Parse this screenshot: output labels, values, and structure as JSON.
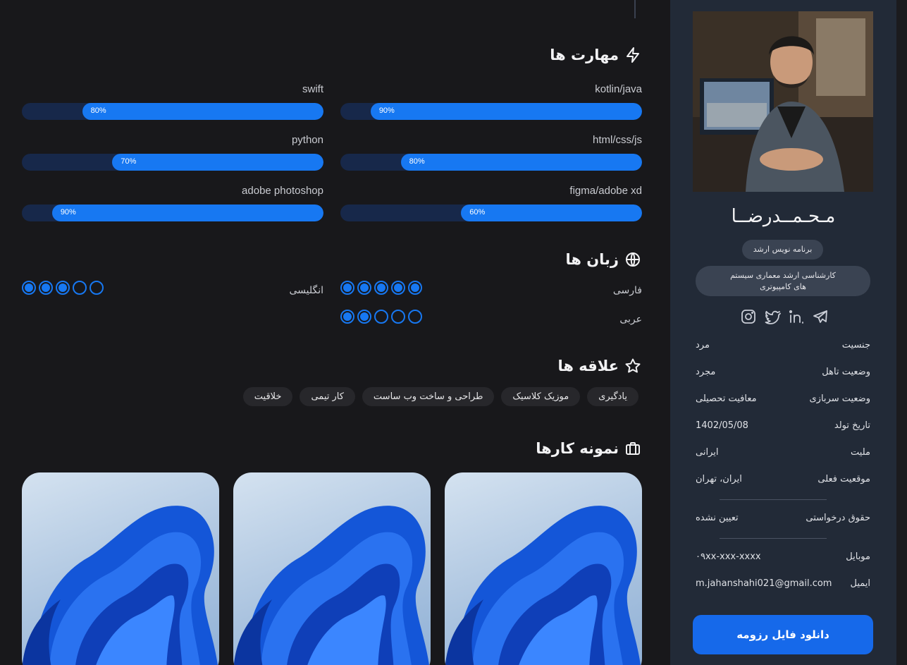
{
  "skills": {
    "title": "مهارت ها",
    "icon": "lightning-icon",
    "items": [
      {
        "label": "kotlin/java",
        "percent": 90,
        "percent_label": "90%"
      },
      {
        "label": "swift",
        "percent": 80,
        "percent_label": "80%"
      },
      {
        "label": "html/css/js",
        "percent": 80,
        "percent_label": "80%"
      },
      {
        "label": "python",
        "percent": 70,
        "percent_label": "70%"
      },
      {
        "label": "figma/adobe xd",
        "percent": 60,
        "percent_label": "60%"
      },
      {
        "label": "adobe photoshop",
        "percent": 90,
        "percent_label": "90%"
      }
    ]
  },
  "languages": {
    "title": "زبان ها",
    "icon": "globe-icon",
    "items": [
      {
        "name": "فارسی",
        "level": 5,
        "max": 5
      },
      {
        "name": "انگلیسی",
        "level": 3,
        "max": 5
      },
      {
        "name": "عربی",
        "level": 2,
        "max": 5
      }
    ]
  },
  "interests": {
    "title": "علاقه ها",
    "icon": "star-icon",
    "items": [
      "یادگیری",
      "موزیک کلاسیک",
      "طراحی و ساخت وب ساست",
      "کار تیمی",
      "خلاقیت"
    ]
  },
  "portfolio": {
    "title": "نمونه کارها",
    "icon": "briefcase-icon",
    "items": [
      "windows-bloom-artwork",
      "windows-bloom-artwork",
      "windows-bloom-artwork"
    ]
  },
  "profile": {
    "name": "مـحـمــدرضــا",
    "role": "برنامه نویس ارشد",
    "degree": "کارشناسی ارشد معماری سیستم های کامپیوتری",
    "socials": [
      "instagram-icon",
      "twitter-icon",
      "linkedin-icon",
      "telegram-icon"
    ],
    "info": [
      {
        "key": "جنسیت",
        "value": "مرد"
      },
      {
        "key": "وضعیت تاهل",
        "value": "مجرد"
      },
      {
        "key": "وضعیت سربازی",
        "value": "معافیت تحصیلی"
      },
      {
        "key": "تاریخ تولد",
        "value": "1402/05/08"
      },
      {
        "key": "ملیت",
        "value": "ایرانی"
      },
      {
        "key": "موقعیت فعلی",
        "value": "ایران، تهران"
      }
    ],
    "salary": {
      "key": "حقوق درخواستی",
      "value": "تعیین نشده"
    },
    "contact": [
      {
        "key": "موبایل",
        "value": "۰۹xx-xxx-xxxx"
      },
      {
        "key": "ایمیل",
        "value": "m.jahanshahi021@gmail.com"
      }
    ],
    "download_label": "دانلود فایل رزومه"
  },
  "colors": {
    "accent": "#1778f2",
    "track": "#17284a",
    "sidebar": "#222a37",
    "background": "#18181b"
  }
}
